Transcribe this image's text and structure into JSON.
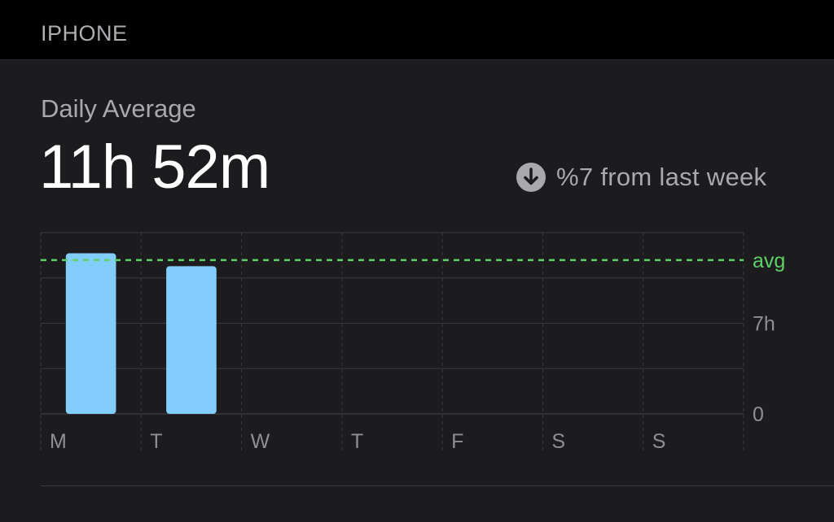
{
  "section": {
    "title": "IPHONE"
  },
  "summary": {
    "label": "Daily Average",
    "value": "11h 52m",
    "trend_icon": "arrow-down-circle-icon",
    "trend_text": "%7 from last week"
  },
  "colors": {
    "background": "#1c1c1e",
    "bar": "#83cdfc",
    "avg_line": "#5fd068",
    "grid": "#3a3a3c",
    "label": "#8e8e93"
  },
  "chart_data": {
    "type": "bar",
    "title": "",
    "xlabel": "",
    "ylabel": "",
    "categories": [
      "M",
      "T",
      "W",
      "T",
      "F",
      "S",
      "S"
    ],
    "values": [
      12.4,
      11.4,
      0,
      0,
      0,
      0,
      0
    ],
    "ylim": [
      0,
      14
    ],
    "unit": "h",
    "y_ticks": [
      {
        "value": 0,
        "label": "0"
      },
      {
        "value": 7,
        "label": "7h"
      }
    ],
    "average": {
      "value": 11.87,
      "label": "avg"
    },
    "grid": true
  }
}
